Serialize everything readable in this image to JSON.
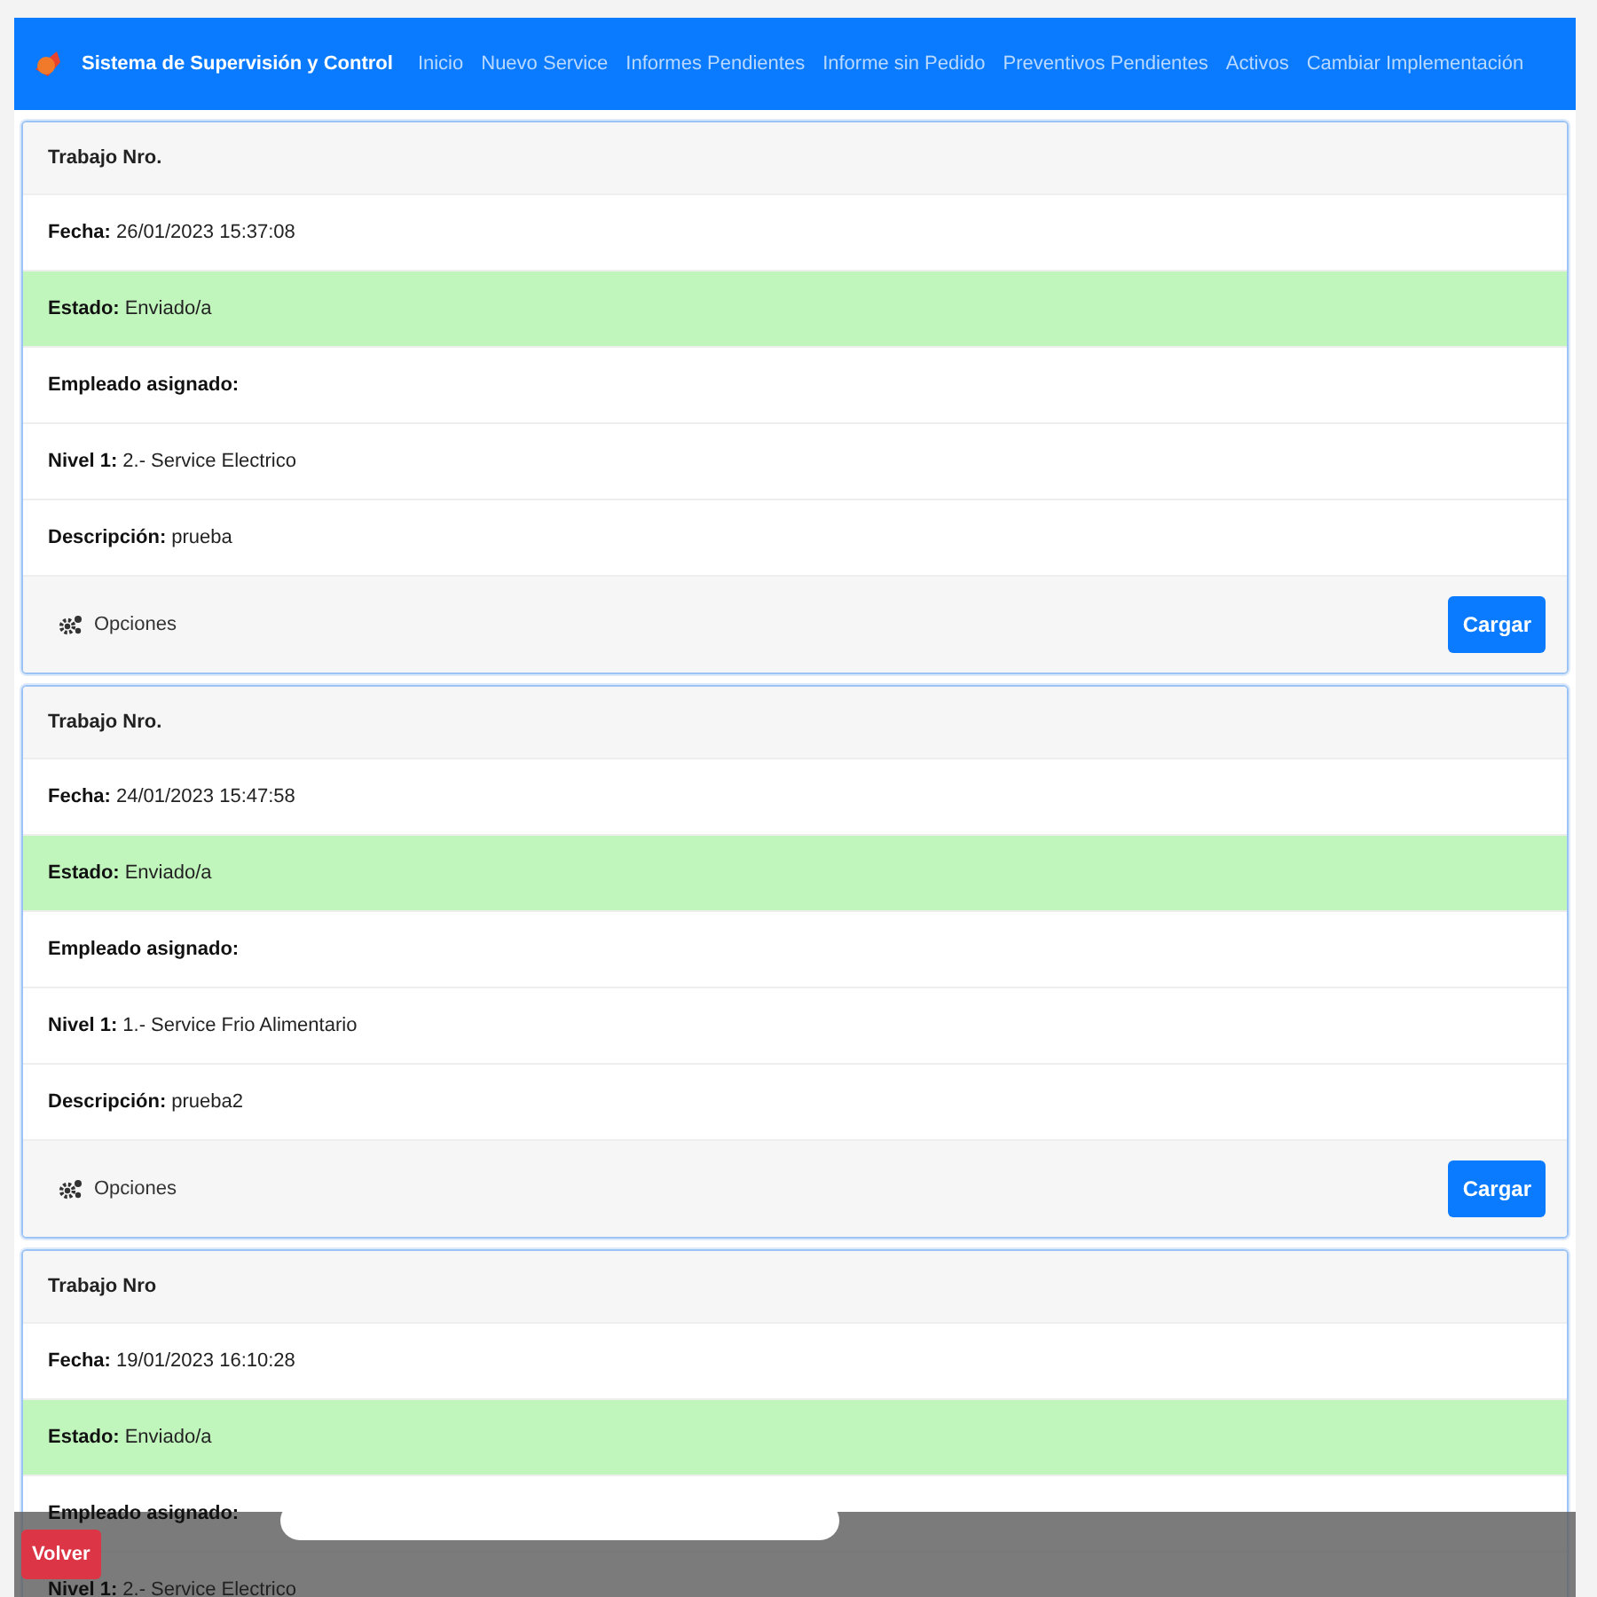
{
  "navbar": {
    "brand": "Sistema de Supervisión y Control",
    "links": [
      "Inicio",
      "Nuevo Service",
      "Informes Pendientes",
      "Informe sin Pedido",
      "Preventivos Pendientes",
      "Activos",
      "Cambiar Implementación"
    ]
  },
  "cards": [
    {
      "header": "Trabajo Nro.",
      "rows": [
        {
          "kind": "plain",
          "label": "Fecha:",
          "value": "26/01/2023 15:37:08"
        },
        {
          "kind": "status",
          "label": "Estado:",
          "value": "Enviado/a"
        },
        {
          "kind": "plain",
          "label": "Empleado asignado:"
        },
        {
          "kind": "plain",
          "label": "Nivel 1:",
          "value": "2.- Service Electrico"
        },
        {
          "kind": "plain",
          "label": "Descripción:",
          "value": "prueba"
        }
      ],
      "footer": {
        "options": "Opciones",
        "button": "Cargar"
      }
    },
    {
      "header": "Trabajo Nro.",
      "rows": [
        {
          "kind": "plain",
          "label": "Fecha:",
          "value": "24/01/2023 15:47:58"
        },
        {
          "kind": "status",
          "label": "Estado:",
          "value": "Enviado/a"
        },
        {
          "kind": "plain",
          "label": "Empleado asignado:"
        },
        {
          "kind": "plain",
          "label": "Nivel 1:",
          "value": "1.- Service Frio Alimentario"
        },
        {
          "kind": "plain",
          "label": "Descripción:",
          "value": "prueba2"
        }
      ],
      "footer": {
        "options": "Opciones",
        "button": "Cargar"
      }
    },
    {
      "header": "Trabajo Nro",
      "rows": [
        {
          "kind": "plain",
          "label": "Fecha:",
          "value": "19/01/2023 16:10:28"
        },
        {
          "kind": "status",
          "label": "Estado:",
          "value": "Enviado/a"
        },
        {
          "kind": "plain",
          "label": "Empleado asignado:"
        },
        {
          "kind": "plain",
          "label": "Nivel 1:",
          "value": "2.- Service Electrico"
        }
      ]
    }
  ],
  "bottom_bar": {
    "button": "Volver"
  }
}
